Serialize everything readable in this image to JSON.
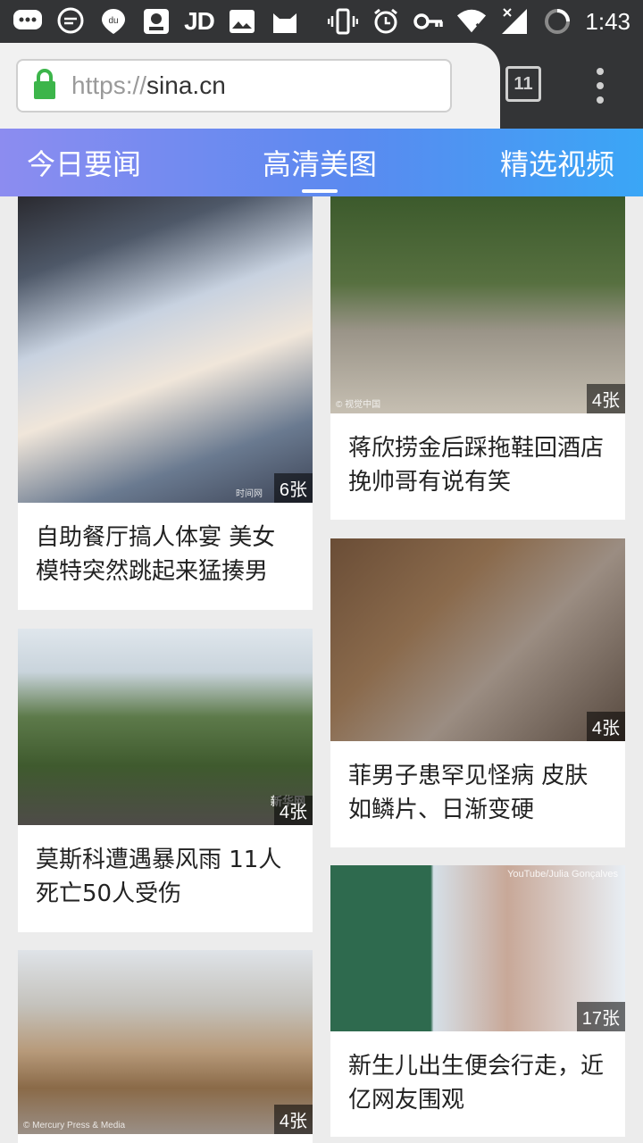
{
  "status_bar": {
    "left_icons": [
      "chat-bubble-icon",
      "message-icon",
      "du-app-icon",
      "photo-app-icon",
      "jd-app-icon",
      "image-icon",
      "cat-app-icon"
    ],
    "jd_label": "JD",
    "du_label": "du",
    "right_icons": [
      "vibrate-icon",
      "alarm-icon",
      "key-icon",
      "wifi-icon",
      "signal-icon",
      "battery-icon"
    ],
    "time": "1:43"
  },
  "browser": {
    "url_scheme": "https://",
    "url_host": "sina.cn",
    "tab_count": "11",
    "secure": true
  },
  "category_tabs": [
    {
      "label": "今日要闻",
      "active": false
    },
    {
      "label": "高清美图",
      "active": true
    },
    {
      "label": "精选视频",
      "active": false
    }
  ],
  "cards": [
    {
      "title": "自助餐厅搞人体宴 美女模特突然跳起来猛揍男",
      "count": "6张",
      "credit": "时间网"
    },
    {
      "title": "蒋欣捞金后踩拖鞋回酒店 挽帅哥有说有笑",
      "count": "4张",
      "credit": "© 视觉中国"
    },
    {
      "title": "菲男子患罕见怪病 皮肤如鳞片、日渐变硬",
      "count": "4张",
      "credit": ""
    },
    {
      "title": "莫斯科遭遇暴风雨 11人死亡50人受伤",
      "count": "4张",
      "credit": "新华网"
    },
    {
      "title": "新生儿出生便会行走，近亿网友围观",
      "count": "17张",
      "credit": "YouTube/Julia Gonçalves"
    },
    {
      "title": "",
      "count": "4张",
      "credit": "© Mercury Press & Media"
    }
  ],
  "colors": {
    "status_bar": "#333436",
    "tab_gradient_start": "#8c8cf0",
    "tab_gradient_end": "#3aa6f6",
    "lock_green": "#3cb54a"
  }
}
